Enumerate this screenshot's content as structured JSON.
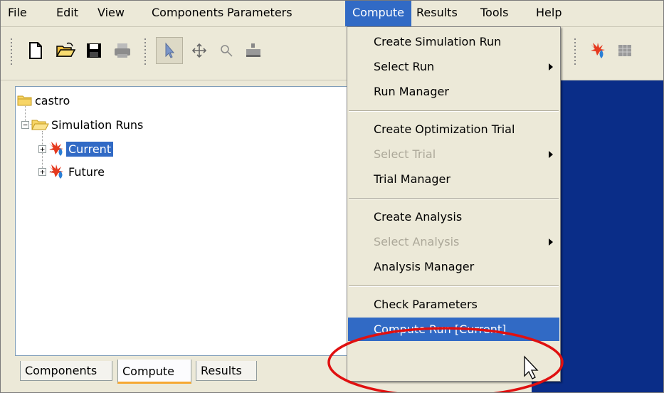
{
  "menubar": {
    "items": [
      "File",
      "Edit",
      "View",
      "Components",
      "Parameters",
      "Compute",
      "Results",
      "Tools",
      "Help"
    ],
    "active_index": 5
  },
  "toolbar": {
    "icons": [
      "new-document-icon",
      "open-folder-icon",
      "save-disk-icon",
      "print-icon",
      "select-pointer-icon",
      "move-icon",
      "zoom-icon",
      "place-component-icon",
      "run-simulation-icon",
      "grid-view-icon"
    ]
  },
  "tree": {
    "root": "castro",
    "simulation_runs": "Simulation Runs",
    "runs": [
      "Current",
      "Future"
    ],
    "selected_run_index": 0
  },
  "tabs": {
    "items": [
      "Components",
      "Compute",
      "Results"
    ],
    "active_index": 1
  },
  "compute_menu": {
    "groups": [
      [
        {
          "label": "Create Simulation Run",
          "disabled": false,
          "submenu": false
        },
        {
          "label": "Select Run",
          "disabled": false,
          "submenu": true
        },
        {
          "label": "Run Manager",
          "disabled": false,
          "submenu": false
        }
      ],
      [
        {
          "label": "Create Optimization Trial",
          "disabled": false,
          "submenu": false
        },
        {
          "label": "Select Trial",
          "disabled": true,
          "submenu": true
        },
        {
          "label": "Trial Manager",
          "disabled": false,
          "submenu": false
        }
      ],
      [
        {
          "label": "Create Analysis",
          "disabled": false,
          "submenu": false
        },
        {
          "label": "Select Analysis",
          "disabled": true,
          "submenu": true
        },
        {
          "label": "Analysis Manager",
          "disabled": false,
          "submenu": false
        }
      ],
      [
        {
          "label": "Check Parameters",
          "disabled": false,
          "submenu": false
        },
        {
          "label": "Compute Run [Current]",
          "disabled": false,
          "submenu": false,
          "highlighted": true
        }
      ]
    ]
  },
  "colors": {
    "highlight": "#316ac5",
    "window_bg": "#ece9d8",
    "dark_panel": "#0a2d88",
    "annotation": "#e01010"
  }
}
